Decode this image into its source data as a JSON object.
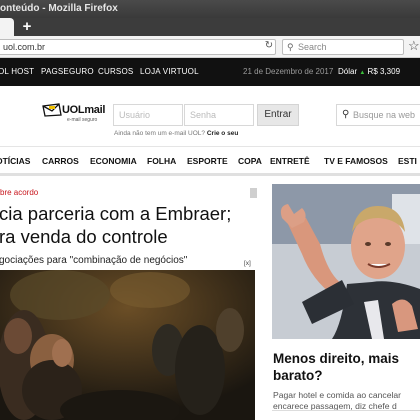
{
  "browser": {
    "window_title": "onteúdo - Mozilla Firefox",
    "new_tab_symbol": "+",
    "url": "uol.com.br",
    "search_placeholder": "Search",
    "icons": [
      "reload-icon",
      "search-icon",
      "bookmark-star-icon"
    ]
  },
  "topbar": {
    "links": [
      "OL HOST",
      "PAGSEGURO",
      "CURSOS",
      "LOJA VIRTUOL"
    ],
    "date": "21 de Dezembro de 2017",
    "dolar_label": "Dólar",
    "dolar_arrow": "▲",
    "dolar_value": "R$ 3,309"
  },
  "header": {
    "logo_text": "UOLmail",
    "logo_subtext": "e-mail seguro",
    "user_placeholder": "Usuário",
    "password_placeholder": "Senha",
    "enter_label": "Entrar",
    "signup_text": "Ainda não tem um e-mail UOL?",
    "signup_link": "Crie o seu",
    "search_placeholder": "Busque na web"
  },
  "categories": [
    "OTÍCIAS",
    "CARROS",
    "ECONOMIA",
    "FOLHA",
    "ESPORTE",
    "COPA",
    "ENTRETÊ",
    "TV E FAMOSOS",
    "ESTI"
  ],
  "main_story": {
    "kicker": "bre acordo",
    "headline_line1": "cia parceria com a Embraer;",
    "headline_line2": "ra venda do controle",
    "subheadline": "gociações para \"combinação de negócios\"",
    "ad_close": "[x]"
  },
  "side_story": {
    "headline": "Menos direito, mais barato?",
    "summary_line1": "Pagar hotel e comida ao cancelar",
    "summary_line2": "encarece passagem, diz chefe d"
  },
  "colors": {
    "topbar_bg": "#111111",
    "kicker": "#c8161d",
    "dolar_up": "#3bbf3b"
  }
}
